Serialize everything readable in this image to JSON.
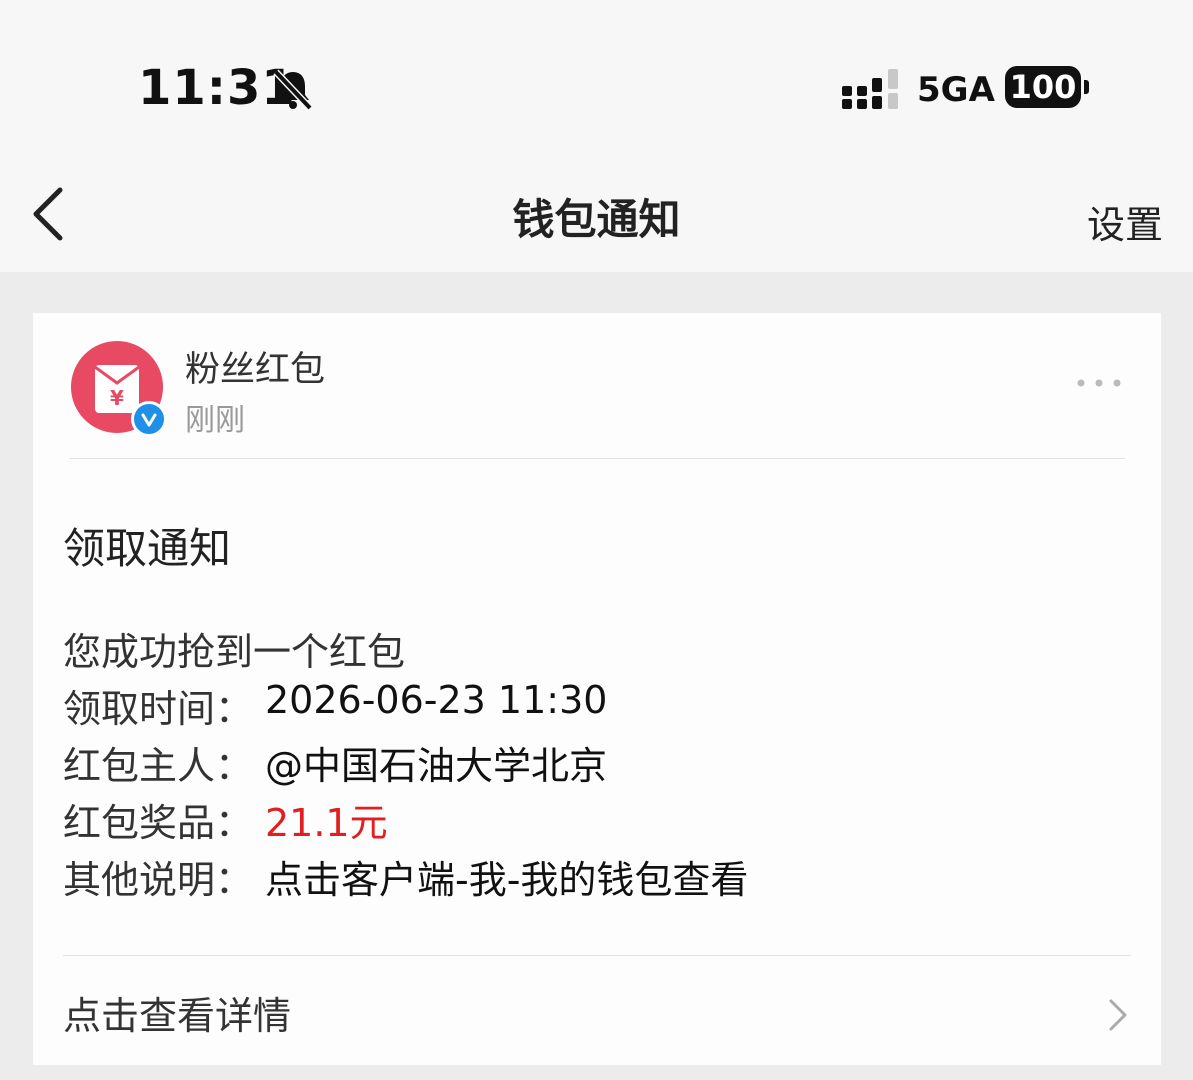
{
  "status_bar": {
    "time": "11:31",
    "network": "5GA",
    "battery": "100"
  },
  "nav": {
    "title": "钱包通知",
    "settings_label": "设置"
  },
  "message": {
    "sender": "粉丝红包",
    "time_ago": "刚刚",
    "title": "领取通知",
    "intro": "您成功抢到一个红包",
    "fields": [
      {
        "label": "领取时间：",
        "value": "2026-06-23 11:30"
      },
      {
        "label": "红包主人：",
        "value": "@中国石油大学北京"
      },
      {
        "label": "红包奖品：",
        "value": "21.1元"
      },
      {
        "label": "其他说明：",
        "value": "点击客户端-我-我的钱包查看"
      }
    ],
    "detail_link": "点击查看详情"
  },
  "colors": {
    "accent_red": "#e02020",
    "avatar_bg": "#e94a63",
    "verified_badge": "#1e90e8"
  }
}
